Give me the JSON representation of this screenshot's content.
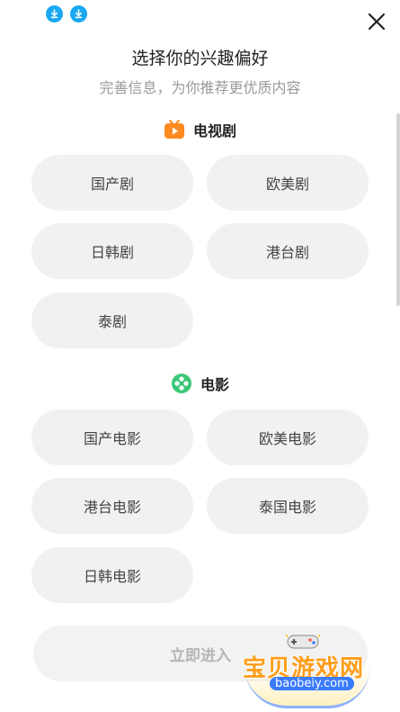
{
  "header": {
    "title": "选择你的兴趣偏好",
    "subtitle": "完善信息，为你推荐更优质内容"
  },
  "sections": [
    {
      "label": "电视剧",
      "icon": "tv-play-icon",
      "icon_color": "#ff8a1f",
      "items": [
        "国产剧",
        "欧美剧",
        "日韩剧",
        "港台剧",
        "泰剧"
      ]
    },
    {
      "label": "电影",
      "icon": "film-reel-icon",
      "icon_color": "#3cc779",
      "items": [
        "国产电影",
        "欧美电影",
        "港台电影",
        "泰国电影",
        "日韩电影"
      ]
    }
  ],
  "submit_label": "立即进入",
  "watermark": {
    "text": "宝贝游戏网",
    "url": "baobeiy.com"
  },
  "colors": {
    "chip_bg": "#f1f1f1",
    "download_icon": "#19a8f2",
    "submit_text": "#b5b5b5"
  }
}
